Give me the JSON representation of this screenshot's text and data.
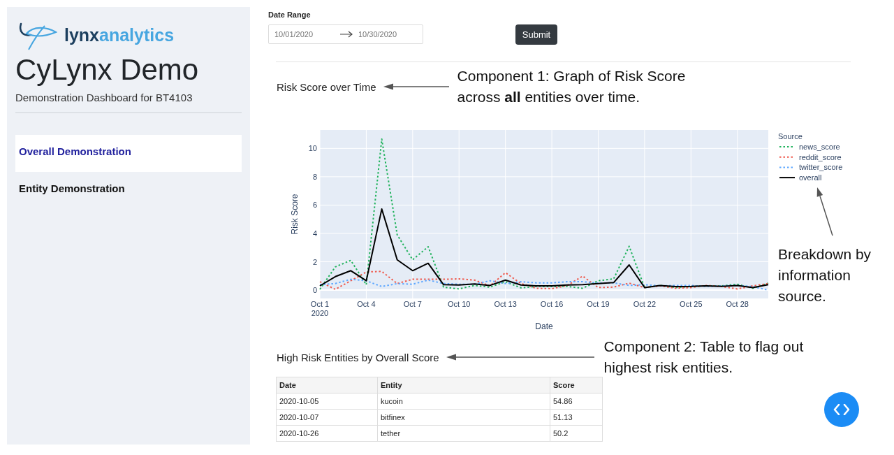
{
  "sidebar": {
    "logo": {
      "dark_part": "lynx",
      "light_part": "analytics"
    },
    "title": "CyLynx Demo",
    "subtitle": "Demonstration Dashboard for BT4103",
    "nav_items": [
      {
        "label": "Overall Demonstration",
        "selected": true
      },
      {
        "label": "Entity Demonstration",
        "selected": false
      }
    ]
  },
  "filters": {
    "label": "Date Range",
    "start_date": "10/01/2020",
    "end_date": "10/30/2020",
    "submit_label": "Submit"
  },
  "risk_chart": {
    "title": "Risk Score over Time",
    "callout": "Component 1: Graph of Risk Score across **all** entities over time.",
    "legend_callout": "Breakdown by information source.",
    "chart_data": {
      "type": "line",
      "xlabel": "Date",
      "ylabel": "Risk Score",
      "grid": true,
      "legend": "right",
      "legend_title": "Source",
      "categories": [
        "Oct 1\n2020",
        null,
        null,
        "Oct 4",
        null,
        null,
        "Oct 7",
        null,
        null,
        "Oct 10",
        null,
        null,
        "Oct 13",
        null,
        null,
        "Oct 16",
        null,
        null,
        "Oct 19",
        null,
        null,
        "Oct 22",
        null,
        null,
        "Oct 25",
        null,
        null,
        "Oct 28",
        null,
        null
      ],
      "ylim": [
        -0.59,
        11.3
      ],
      "yticks": [
        0,
        2,
        4,
        6,
        8,
        10
      ],
      "series": [
        {
          "name": "news_score",
          "color": "#22b35e",
          "line_style": "dotted",
          "values": [
            0.05,
            1.64,
            2.1,
            0.38,
            10.66,
            3.9,
            2.14,
            3.06,
            0.21,
            0.08,
            0.33,
            0.21,
            0.59,
            0.16,
            0.26,
            0.25,
            0.26,
            0.13,
            0.66,
            0.79,
            3.09,
            0.18,
            0.33,
            0.18,
            0.25,
            0.3,
            0.3,
            0.41,
            0.13,
            0.49
          ]
        },
        {
          "name": "reddit_score",
          "color": "#ef5b4f",
          "line_style": "dotted",
          "values": [
            0.59,
            0.05,
            0.66,
            1.28,
            1.32,
            0.46,
            0.76,
            0.76,
            0.76,
            0.79,
            0.71,
            0.3,
            1.23,
            0.46,
            0.13,
            0.1,
            0.33,
            0.99,
            0.18,
            0.21,
            0.49,
            0.18,
            0.3,
            0.13,
            0.18,
            0.33,
            0.25,
            0.08,
            0.3,
            0.46
          ]
        },
        {
          "name": "twitter_score",
          "color": "#5fa8ff",
          "line_style": "dotted",
          "values": [
            0.38,
            0.46,
            0.76,
            0.66,
            0.25,
            0.46,
            0.41,
            0.71,
            0.46,
            0.41,
            0.41,
            0.66,
            0.46,
            0.59,
            0.51,
            0.51,
            0.59,
            0.59,
            0.49,
            0.51,
            0.33,
            0.38,
            0.3,
            0.33,
            0.33,
            0.25,
            0.3,
            0.33,
            0.25,
            0.0
          ]
        },
        {
          "name": "overall",
          "color": "#000000",
          "line_style": "solid",
          "values": [
            0.3,
            0.95,
            1.37,
            0.66,
            5.72,
            2.14,
            1.37,
            1.89,
            0.38,
            0.36,
            0.43,
            0.33,
            0.71,
            0.36,
            0.3,
            0.3,
            0.36,
            0.38,
            0.46,
            0.53,
            1.78,
            0.18,
            0.33,
            0.25,
            0.26,
            0.3,
            0.26,
            0.33,
            0.18,
            0.38
          ]
        }
      ]
    }
  },
  "entities_table": {
    "title": "High Risk Entities by Overall Score",
    "callout": "Component 2: Table to flag out highest risk entities.",
    "columns": [
      "Date",
      "Entity",
      "Score"
    ],
    "rows": [
      [
        "2020-10-05",
        "kucoin",
        "54.86"
      ],
      [
        "2020-10-07",
        "bitfinex",
        "51.13"
      ],
      [
        "2020-10-26",
        "tether",
        "50.2"
      ]
    ]
  }
}
